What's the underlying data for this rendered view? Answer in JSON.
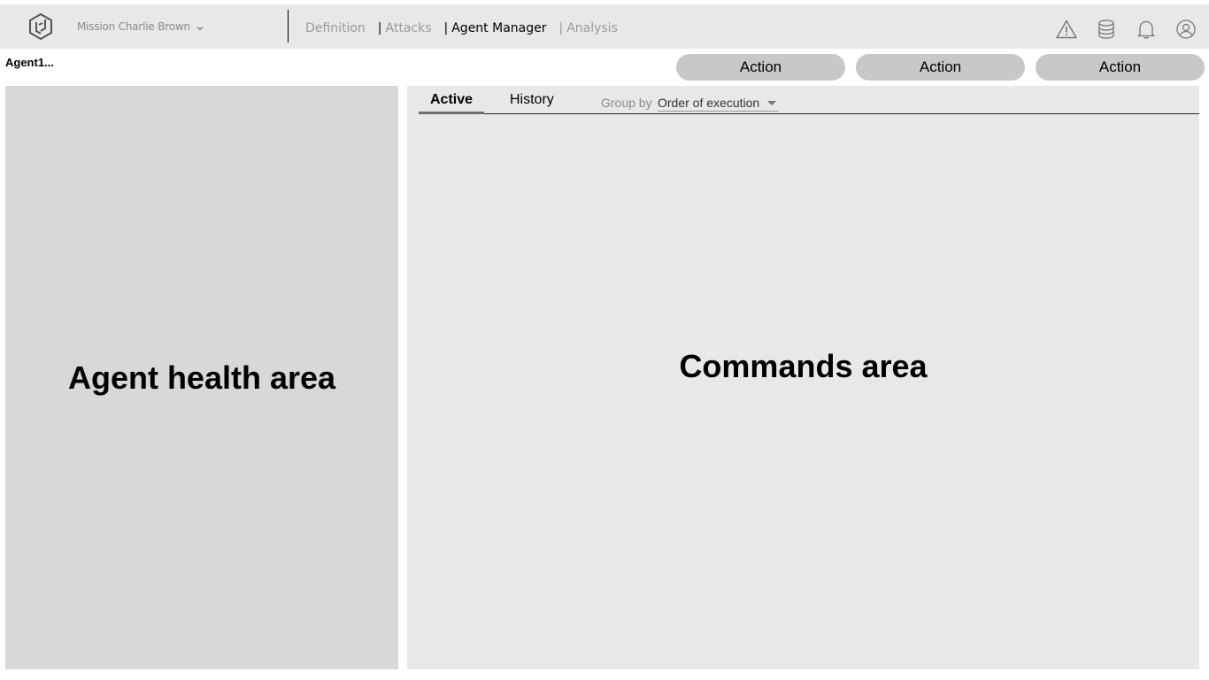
{
  "header": {
    "logo_icon": "hexagon-logo-icon",
    "mission": "Mission Charlie Brown",
    "nav": [
      {
        "label": "Definition",
        "active": false
      },
      {
        "label": "Attacks",
        "active": false
      },
      {
        "label": "Agent Manager",
        "active": true
      },
      {
        "label": "Analysis",
        "active": false
      }
    ],
    "nav_separator": "|",
    "icons": [
      "warning-icon",
      "database-icon",
      "bell-icon",
      "user-icon"
    ]
  },
  "agent": {
    "name": "Agent1..."
  },
  "actions": [
    "Action",
    "Action",
    "Action"
  ],
  "health_panel": {
    "label": "Agent health area"
  },
  "commands_panel": {
    "tabs": [
      {
        "label": "Active",
        "active": true
      },
      {
        "label": "History",
        "active": false
      }
    ],
    "group_by_label": "Group by",
    "group_by_value": "Order of execution",
    "label": "Commands area"
  },
  "colors": {
    "topbar_bg": "#e8e8e8",
    "health_bg": "#d8d8d8",
    "commands_bg": "#e8e8e8",
    "action_bg": "#c8c8c8",
    "muted_text": "#9a9a9a"
  }
}
